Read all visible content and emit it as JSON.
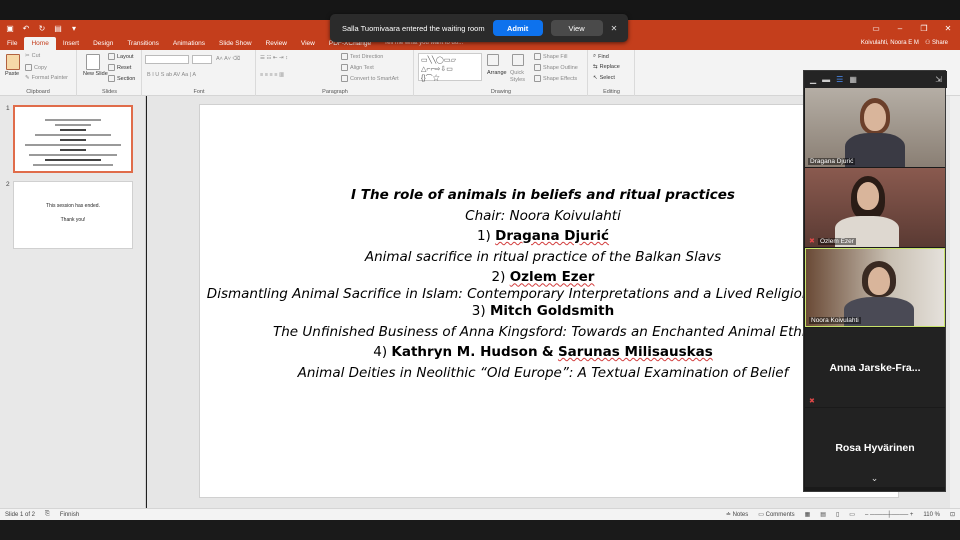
{
  "notification": {
    "message": "Salla Tuomivaara entered the waiting room",
    "admit_label": "Admit",
    "view_label": "View",
    "close_glyph": "✕"
  },
  "ribbon_tabs": [
    "File",
    "Home",
    "Insert",
    "Design",
    "Transitions",
    "Animations",
    "Slide Show",
    "Review",
    "View",
    "PDF-XChange"
  ],
  "tell_me": "Tell me what you want to do...",
  "account": "Koivulahti, Noora E M",
  "share_label": "Share",
  "ribbon": {
    "clipboard": {
      "label": "Clipboard",
      "paste": "Paste",
      "cut": "Cut",
      "copy": "Copy",
      "format_painter": "Format Painter"
    },
    "slides": {
      "label": "Slides",
      "new_slide": "New Slide",
      "layout": "Layout",
      "reset": "Reset",
      "section": "Section"
    },
    "font": {
      "label": "Font"
    },
    "paragraph": {
      "label": "Paragraph",
      "text_direction": "Text Direction",
      "align_text": "Align Text",
      "convert_smartart": "Convert to SmartArt"
    },
    "drawing": {
      "label": "Drawing",
      "arrange": "Arrange",
      "quick_styles": "Quick Styles",
      "shape_fill": "Shape Fill",
      "shape_outline": "Shape Outline",
      "shape_effects": "Shape Effects"
    },
    "editing": {
      "label": "Editing",
      "find": "Find",
      "replace": "Replace",
      "select": "Select"
    }
  },
  "thumbnails": [
    {
      "number": "1"
    },
    {
      "number": "2",
      "line1": "This session has ended.",
      "line2": "Thank you!"
    }
  ],
  "slide": {
    "heading": "I The role of animals in beliefs and ritual practices",
    "chair": "Chair: Noora Koivulahti",
    "p1_num": "1)",
    "p1_name": "Dragana Djurić",
    "p1_title": "Animal sacrifice in ritual practice of the Balkan Slavs",
    "p2_num": "2)",
    "p2_name": "Ozlem Ezer",
    "p2_title": "Dismantling Animal Sacrifice in Islam: Contemporary Interpretations and a Lived Religion Approach",
    "p3_num": "3)",
    "p3_name": "Mitch Goldsmith",
    "p3_title": "The Unfinished Business of Anna Kingsford: Towards an Enchanted Animal Ethic",
    "p4_num": "4)",
    "p4_name_a": "Kathryn M. Hudson",
    "p4_amp": "&",
    "p4_name_b": "Sarunas Milisauskas",
    "p4_title": "Animal Deities in Neolithic “Old Europe”: A Textual Examination of Belief"
  },
  "participants": [
    {
      "name": "Dragana Djurić",
      "video": true
    },
    {
      "name": "Ozlem Ezer",
      "video": true,
      "muted": true
    },
    {
      "name": "Noora Koivulahti",
      "video": true,
      "active": true
    },
    {
      "name": "Anna Jarske-Fra...",
      "video": false,
      "muted": true
    },
    {
      "name": "Rosa Hyvärinen",
      "video": false
    }
  ],
  "status": {
    "slide_of": "Slide 1 of 2",
    "language": "Finnish",
    "notes": "Notes",
    "comments": "Comments",
    "zoom": "110 %"
  },
  "colors": {
    "accent": "#c43e1c",
    "admit": "#0e72ed",
    "active_speaker": "#c8e36a"
  }
}
